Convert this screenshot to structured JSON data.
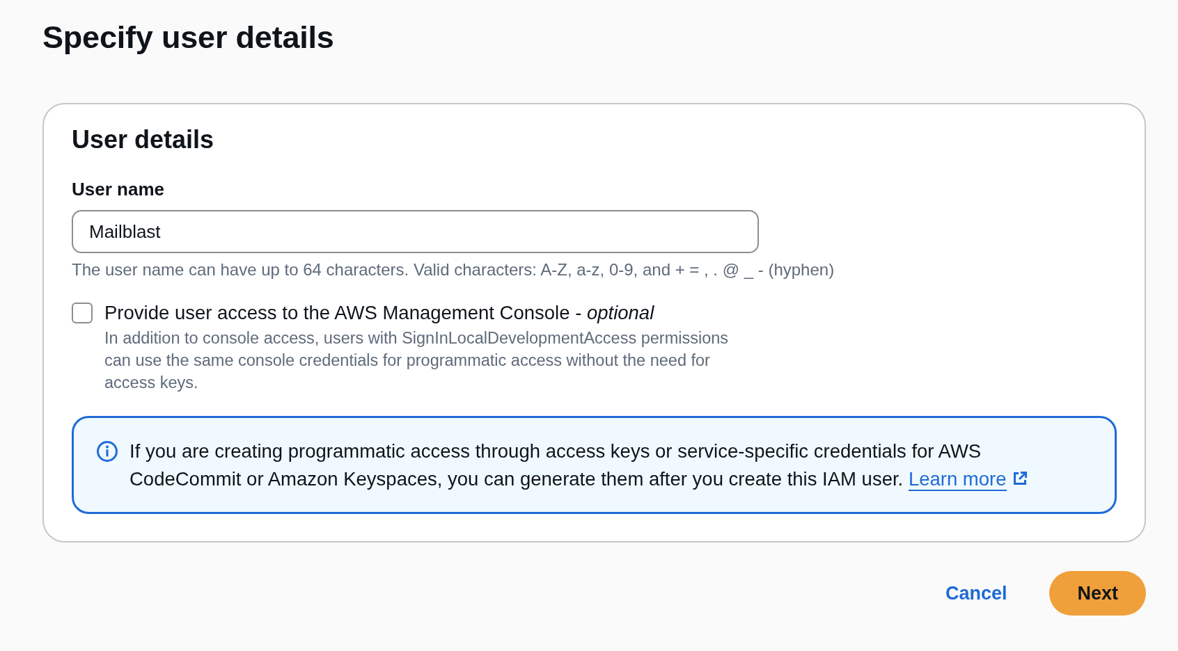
{
  "page": {
    "title": "Specify user details"
  },
  "user_details": {
    "heading": "User details",
    "user_name": {
      "label": "User name",
      "value": "Mailblast",
      "hint": "The user name can have up to 64 characters. Valid characters: A-Z, a-z, 0-9, and + = , . @ _ - (hyphen)"
    },
    "console_access": {
      "checked": false,
      "label": "Provide user access to the AWS Management Console - *optional*",
      "description": "In addition to console access, users with SignInLocalDevelopmentAccess permissions can use the same console credentials for programmatic access without the need for access keys."
    },
    "info_alert": {
      "text": "If you are creating programmatic access through access keys or service-specific credentials for AWS CodeCommit or Amazon Keyspaces, you can generate them after you create this IAM user.",
      "link": "Learn more"
    }
  },
  "actions": [
    {
      "label": "Cancel",
      "kind": "link"
    },
    {
      "label": "Next",
      "kind": "primary"
    }
  ]
}
